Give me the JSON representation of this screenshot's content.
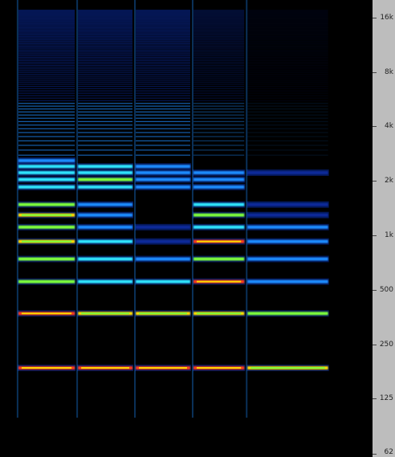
{
  "chart_data": {
    "type": "heatmap",
    "title": "",
    "xlabel": "",
    "ylabel": "",
    "y_scale": "log",
    "y_unit": "Hz",
    "ylim": [
      62,
      20000
    ],
    "y_ticks": [
      {
        "value": 16000,
        "label": "16k"
      },
      {
        "value": 8000,
        "label": "8k"
      },
      {
        "value": 4000,
        "label": "4k"
      },
      {
        "value": 2000,
        "label": "2k"
      },
      {
        "value": 1000,
        "label": "1k"
      },
      {
        "value": 500,
        "label": "500"
      },
      {
        "value": 250,
        "label": "250"
      },
      {
        "value": 125,
        "label": "125"
      },
      {
        "value": 62,
        "label": "62"
      }
    ],
    "colors": {
      "background": "#000000",
      "low": "#0a2a9a",
      "mid": "#1e8cff",
      "high": "#2ee6ff",
      "peak": "#7dff3a",
      "max": "#ffdc00",
      "hot": "#ff3a1a",
      "axis_panel": "#bdbdbd"
    },
    "segments": [
      {
        "name": "",
        "x_start": 0.045,
        "x_end": 0.205,
        "fundamental_hz": 185,
        "harmonics": [
          {
            "n": 1,
            "level": 0.98
          },
          {
            "n": 2,
            "level": 0.92
          },
          {
            "n": 3,
            "level": 0.75
          },
          {
            "n": 4,
            "level": 0.8
          },
          {
            "n": 5,
            "level": 0.82
          },
          {
            "n": 6,
            "level": 0.78
          },
          {
            "n": 7,
            "level": 0.85
          },
          {
            "n": 8,
            "level": 0.7
          },
          {
            "n": 10,
            "level": 0.6
          },
          {
            "n": 11,
            "level": 0.6
          },
          {
            "n": 12,
            "level": 0.55
          },
          {
            "n": 13,
            "level": 0.5
          },
          {
            "n": 14,
            "level": 0.45
          }
        ]
      },
      {
        "name": "",
        "x_start": 0.205,
        "x_end": 0.36,
        "fundamental_hz": 185,
        "harmonics": [
          {
            "n": 1,
            "level": 0.98
          },
          {
            "n": 2,
            "level": 0.9
          },
          {
            "n": 3,
            "level": 0.55
          },
          {
            "n": 4,
            "level": 0.5
          },
          {
            "n": 5,
            "level": 0.5
          },
          {
            "n": 6,
            "level": 0.45
          },
          {
            "n": 7,
            "level": 0.45
          },
          {
            "n": 8,
            "level": 0.4
          },
          {
            "n": 10,
            "level": 0.65
          },
          {
            "n": 11,
            "level": 0.7
          },
          {
            "n": 12,
            "level": 0.6
          },
          {
            "n": 13,
            "level": 0.5
          }
        ]
      },
      {
        "name": "",
        "x_start": 0.36,
        "x_end": 0.515,
        "fundamental_hz": 185,
        "harmonics": [
          {
            "n": 1,
            "level": 0.95
          },
          {
            "n": 2,
            "level": 0.88
          },
          {
            "n": 3,
            "level": 0.5
          },
          {
            "n": 4,
            "level": 0.3
          },
          {
            "n": 5,
            "level": 0.25
          },
          {
            "n": 6,
            "level": 0.25
          },
          {
            "n": 10,
            "level": 0.45
          },
          {
            "n": 11,
            "level": 0.45
          },
          {
            "n": 12,
            "level": 0.4
          },
          {
            "n": 13,
            "level": 0.35
          }
        ]
      },
      {
        "name": "",
        "x_start": 0.515,
        "x_end": 0.66,
        "fundamental_hz": 185,
        "harmonics": [
          {
            "n": 1,
            "level": 0.95
          },
          {
            "n": 2,
            "level": 0.9
          },
          {
            "n": 3,
            "level": 0.95
          },
          {
            "n": 4,
            "level": 0.75
          },
          {
            "n": 5,
            "level": 0.93
          },
          {
            "n": 6,
            "level": 0.6
          },
          {
            "n": 7,
            "level": 0.7
          },
          {
            "n": 8,
            "level": 0.55
          },
          {
            "n": 10,
            "level": 0.4
          },
          {
            "n": 11,
            "level": 0.35
          },
          {
            "n": 12,
            "level": 0.3
          }
        ]
      },
      {
        "name": "",
        "x_start": 0.66,
        "x_end": 0.885,
        "fundamental_hz": 185,
        "harmonics": [
          {
            "n": 1,
            "level": 0.9
          },
          {
            "n": 2,
            "level": 0.75
          },
          {
            "n": 3,
            "level": 0.4
          },
          {
            "n": 4,
            "level": 0.35
          },
          {
            "n": 5,
            "level": 0.3
          },
          {
            "n": 6,
            "level": 0.28
          },
          {
            "n": 7,
            "level": 0.25
          },
          {
            "n": 8,
            "level": 0.2
          },
          {
            "n": 12,
            "level": 0.15
          }
        ]
      }
    ],
    "grid": false,
    "legend": "none"
  }
}
